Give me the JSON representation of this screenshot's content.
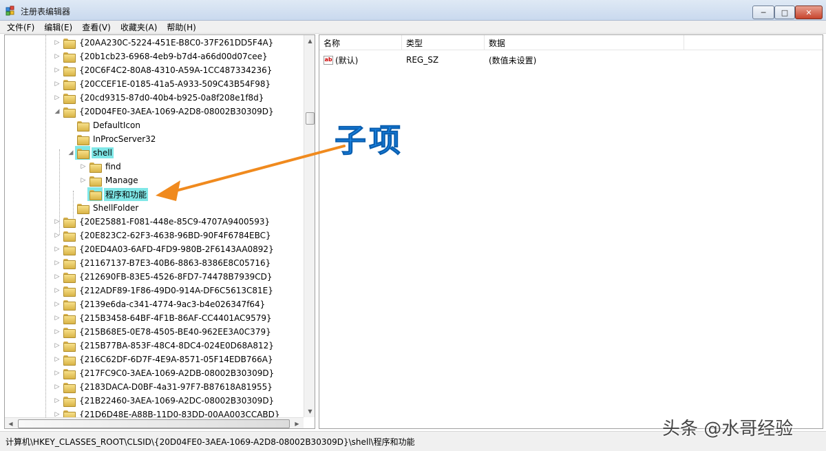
{
  "window": {
    "title": "注册表编辑器",
    "buttons": {
      "minimize": "─",
      "maximize": "□",
      "close": "✕"
    }
  },
  "menu": [
    "文件(F)",
    "编辑(E)",
    "查看(V)",
    "收藏夹(A)",
    "帮助(H)"
  ],
  "tree": [
    {
      "label": "{20AA230C-5224-451E-B8C0-37F261DD5F4A}",
      "depth": 0,
      "expander": "right"
    },
    {
      "label": "{20b1cb23-6968-4eb9-b7d4-a66d00d07cee}",
      "depth": 0,
      "expander": "right"
    },
    {
      "label": "{20C6F4C2-80A8-4310-A59A-1CC487334236}",
      "depth": 0,
      "expander": "right"
    },
    {
      "label": "{20CCEF1E-0185-41a5-A933-509C43B54F98}",
      "depth": 0,
      "expander": "right"
    },
    {
      "label": "{20cd9315-87d0-40b4-b925-0a8f208e1f8d}",
      "depth": 0,
      "expander": "right"
    },
    {
      "label": "{20D04FE0-3AEA-1069-A2D8-08002B30309D}",
      "depth": 0,
      "expander": "down"
    },
    {
      "label": "DefaultIcon",
      "depth": 1,
      "expander": "none"
    },
    {
      "label": "InProcServer32",
      "depth": 1,
      "expander": "none"
    },
    {
      "label": "shell",
      "depth": 1,
      "expander": "down",
      "highlight": true
    },
    {
      "label": "find",
      "depth": 2,
      "expander": "right"
    },
    {
      "label": "Manage",
      "depth": 2,
      "expander": "right"
    },
    {
      "label": "程序和功能",
      "depth": 2,
      "expander": "none",
      "highlight": true
    },
    {
      "label": "ShellFolder",
      "depth": 1,
      "expander": "none"
    },
    {
      "label": "{20E25881-F081-448e-85C9-4707A9400593}",
      "depth": 0,
      "expander": "right"
    },
    {
      "label": "{20E823C2-62F3-4638-96BD-90F4F6784EBC}",
      "depth": 0,
      "expander": "right"
    },
    {
      "label": "{20ED4A03-6AFD-4FD9-980B-2F6143AA0892}",
      "depth": 0,
      "expander": "right"
    },
    {
      "label": "{21167137-B7E3-40B6-8863-8386E8C05716}",
      "depth": 0,
      "expander": "right"
    },
    {
      "label": "{212690FB-83E5-4526-8FD7-74478B7939CD}",
      "depth": 0,
      "expander": "right"
    },
    {
      "label": "{212ADF89-1F86-49D0-914A-DF6C5613C81E}",
      "depth": 0,
      "expander": "right"
    },
    {
      "label": "{2139e6da-c341-4774-9ac3-b4e026347f64}",
      "depth": 0,
      "expander": "right"
    },
    {
      "label": "{215B3458-64BF-4F1B-86AF-CC4401AC9579}",
      "depth": 0,
      "expander": "right"
    },
    {
      "label": "{215B68E5-0E78-4505-BE40-962EE3A0C379}",
      "depth": 0,
      "expander": "right"
    },
    {
      "label": "{215B77BA-853F-48C4-8DC4-024E0D68A812}",
      "depth": 0,
      "expander": "right"
    },
    {
      "label": "{216C62DF-6D7F-4E9A-8571-05F14EDB766A}",
      "depth": 0,
      "expander": "right"
    },
    {
      "label": "{217FC9C0-3AEA-1069-A2DB-08002B30309D}",
      "depth": 0,
      "expander": "right"
    },
    {
      "label": "{2183DACA-D0BF-4a31-97F7-B87618A81955}",
      "depth": 0,
      "expander": "right"
    },
    {
      "label": "{21B22460-3AEA-1069-A2DC-08002B30309D}",
      "depth": 0,
      "expander": "right"
    },
    {
      "label": "{21D6D48E-A88B-11D0-83DD-00AA003CCABD}",
      "depth": 0,
      "expander": "right"
    }
  ],
  "list": {
    "columns": [
      "名称",
      "类型",
      "数据"
    ],
    "rows": [
      {
        "name": "(默认)",
        "type": "REG_SZ",
        "data": "(数值未设置)",
        "icon": "ab"
      }
    ]
  },
  "status": {
    "path": "计算机\\HKEY_CLASSES_ROOT\\CLSID\\{20D04FE0-3AEA-1069-A2D8-08002B30309D}\\shell\\程序和功能"
  },
  "annotation": {
    "label": "子项",
    "color": "#1a8cf0",
    "arrow_color": "#f08a1e"
  },
  "watermark": "头条 @水哥经验",
  "colors": {
    "highlight": "#7fe7e7",
    "titlebar": "#dfe9f5"
  }
}
